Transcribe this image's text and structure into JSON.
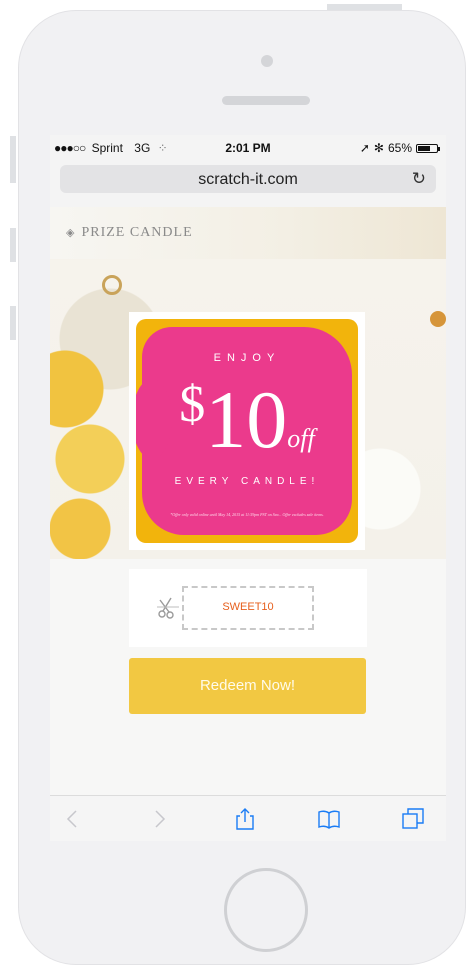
{
  "status_bar": {
    "signal_dots": "●●●○○",
    "carrier": "Sprint",
    "network": "3G",
    "time": "2:01 PM",
    "battery_percent": "65%",
    "battery_level": 0.65
  },
  "browser": {
    "url": "scratch-it.com"
  },
  "page": {
    "brand": "PRIZE CANDLE",
    "coupon": {
      "enjoy": "ENJOY",
      "dollar": "$",
      "amount": "10",
      "off": "off",
      "every": "EVERY CANDLE!",
      "fine_print": "*Offer only valid online until May 14, 2015 at 11:59pm PST on Sea... Offer excludes sale items."
    },
    "promo_code": "SWEET10",
    "redeem_label": "Redeem Now!"
  },
  "colors": {
    "accent_pink": "#eb3a8c",
    "accent_yellow": "#f2c842",
    "code_orange": "#e7601e",
    "toolbar_blue": "#1a7cf5"
  },
  "toolbar_icons": [
    "back-icon",
    "forward-icon",
    "share-icon",
    "bookmarks-icon",
    "tabs-icon"
  ]
}
